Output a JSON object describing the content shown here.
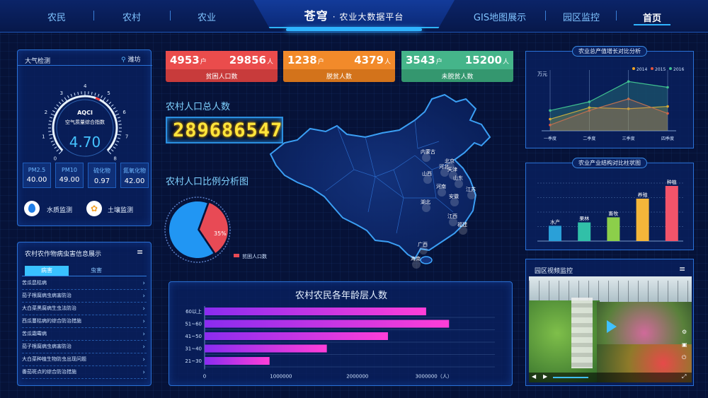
{
  "nav": {
    "left": [
      "农民",
      "农村",
      "农业"
    ],
    "title_main": "苍穹",
    "title_sub": "· 农业大数据平台",
    "right": [
      "GIS地图展示",
      "园区监控"
    ],
    "home": "首页"
  },
  "air": {
    "title": "大气检测",
    "location": "潍坊",
    "gauge_label": "AQCI",
    "gauge_sublabel": "空气质量综合指数",
    "value": "4.70",
    "value_num": 4.7,
    "ticks": [
      "0",
      "1",
      "2",
      "3",
      "4",
      "5",
      "6",
      "7",
      "8"
    ],
    "metrics": [
      {
        "k": "PM2.5",
        "v": "40.00"
      },
      {
        "k": "PM10",
        "v": "49.00"
      },
      {
        "k": "硫化物",
        "v": "0.97"
      },
      {
        "k": "氮氧化物",
        "v": "42.00"
      }
    ],
    "water_label": "水质监测",
    "soil_label": "土壤监测"
  },
  "pest": {
    "title": "农村农作物病虫害信息展示",
    "tab_disease": "病害",
    "tab_insect": "虫害",
    "items": [
      "苦瓜昆枯病",
      "茄子根腐病虫病害防治",
      "大白菜黑腐病生虫法防治",
      "西瓜蔓枯病的综合防治措施",
      "苦瓜霜霉病",
      "茄子根腐病虫病害防治",
      "大白菜种植生物防虫出现问题",
      "番茄斑点的综合防治措施"
    ]
  },
  "kpis": [
    {
      "households": "4953",
      "hh_unit": "户",
      "people": "29856",
      "p_unit": "人",
      "label": "贫困人口数",
      "color_top": "#ea4c4c",
      "color_bottom": "#c83b3b"
    },
    {
      "households": "1238",
      "hh_unit": "户",
      "people": "4379",
      "p_unit": "人",
      "label": "脱贫人数",
      "color_top": "#f28a2a",
      "color_bottom": "#d3731b"
    },
    {
      "households": "3543",
      "hh_unit": "户",
      "people": "15200",
      "p_unit": "人",
      "label": "未脱贫人数",
      "color_top": "#45b58a",
      "color_bottom": "#34976f"
    }
  ],
  "population": {
    "title": "农村人口总人数",
    "total": "289686547",
    "ratio_title": "农村人口比例分析图",
    "legend": "贫困人口数"
  },
  "map_labels": [
    "内蒙古",
    "北京",
    "河北",
    "山西",
    "天津",
    "山东",
    "河南",
    "江苏",
    "湖北",
    "安徽",
    "江西",
    "福建",
    "广西",
    "海南"
  ],
  "chart_data": [
    {
      "type": "pie",
      "labels": [
        "贫困人口数",
        ""
      ],
      "values": [
        35,
        65
      ],
      "slice_label": "35%",
      "colors": [
        "#e84a55",
        "#2196f3"
      ]
    },
    {
      "type": "bar",
      "orientation": "horizontal",
      "title": "农村农民各年龄层人数",
      "categories": [
        "60以上",
        "51~60",
        "41~50",
        "31~40",
        "21~30"
      ],
      "values": [
        2900000,
        3200000,
        2400000,
        1600000,
        850000
      ],
      "ticks": [
        "0",
        "1000000",
        "2000000",
        "3000000（人）"
      ],
      "xlim": [
        0,
        3800000
      ]
    },
    {
      "type": "line",
      "title": "农业总产值增长对比分析",
      "ylabel": "万元",
      "categories": [
        "一季度",
        "二季度",
        "三季度",
        "四季度"
      ],
      "series": [
        {
          "name": "2014",
          "values": [
            20,
            40,
            38,
            42
          ],
          "color": "#f5a623"
        },
        {
          "name": "2015",
          "values": [
            10,
            35,
            55,
            30
          ],
          "color": "#e8543b"
        },
        {
          "name": "2016",
          "values": [
            35,
            50,
            85,
            75
          ],
          "color": "#3fbf8f"
        }
      ],
      "ylim": [
        0,
        100
      ]
    },
    {
      "type": "bar",
      "title": "农业产业结构对比柱状图",
      "categories": [
        "水产",
        "果林",
        "畜牧",
        "养殖",
        "种植"
      ],
      "values": [
        18,
        22,
        28,
        50,
        65
      ],
      "colors": [
        "#2aa0d8",
        "#31c0a8",
        "#8ccf4a",
        "#f4b63a",
        "#f2546a"
      ],
      "ylim": [
        0,
        75
      ]
    }
  ],
  "video": {
    "title": "园区视频监控"
  }
}
